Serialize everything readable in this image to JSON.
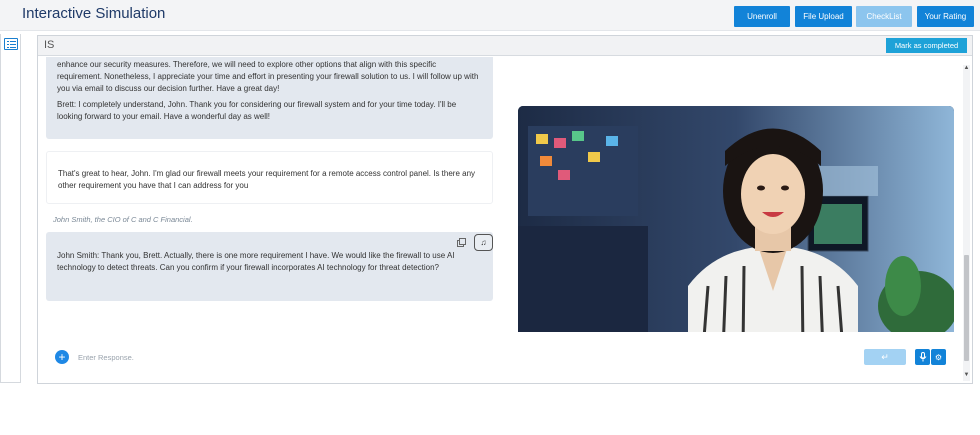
{
  "app": {
    "title": "Interactive Simulation"
  },
  "toolbar": {
    "unenroll": "Unenroll",
    "file_upload": "File Upload",
    "checklist": "CheckList",
    "your_rating": "Your Rating"
  },
  "module": {
    "title": "IS",
    "mark_completed": "Mark as completed"
  },
  "chat": {
    "msg1_p1": "enhance our security measures. Therefore, we will need to explore other options that align with this specific requirement. Nonetheless, I appreciate your time and effort in presenting your firewall solution to us. I will follow up with you via email to discuss our decision further. Have a great day!",
    "msg1_p2": "Brett: I completely understand, John. Thank you for considering our firewall system and for your time today. I'll be looking forward to your email. Have a wonderful day as well!",
    "msg2": "That's great to hear, John. I'm glad our firewall meets your requirement for a remote access control panel. Is there any other requirement you have that I can address for you",
    "speaker": "John Smith, the CIO of C and C Financial.",
    "msg3": "John Smith: Thank you, Brett. Actually, there is one more requirement I have. We would like the firewall to use AI technology to detect threats. Can you confirm if your firewall incorporates AI technology for threat detection?"
  },
  "input": {
    "placeholder": "Enter Response."
  },
  "colors": {
    "primary": "#1283d8",
    "disabled": "#8cc5ee",
    "accent": "#1ea2d8",
    "bubble": "#e3e8ef"
  }
}
